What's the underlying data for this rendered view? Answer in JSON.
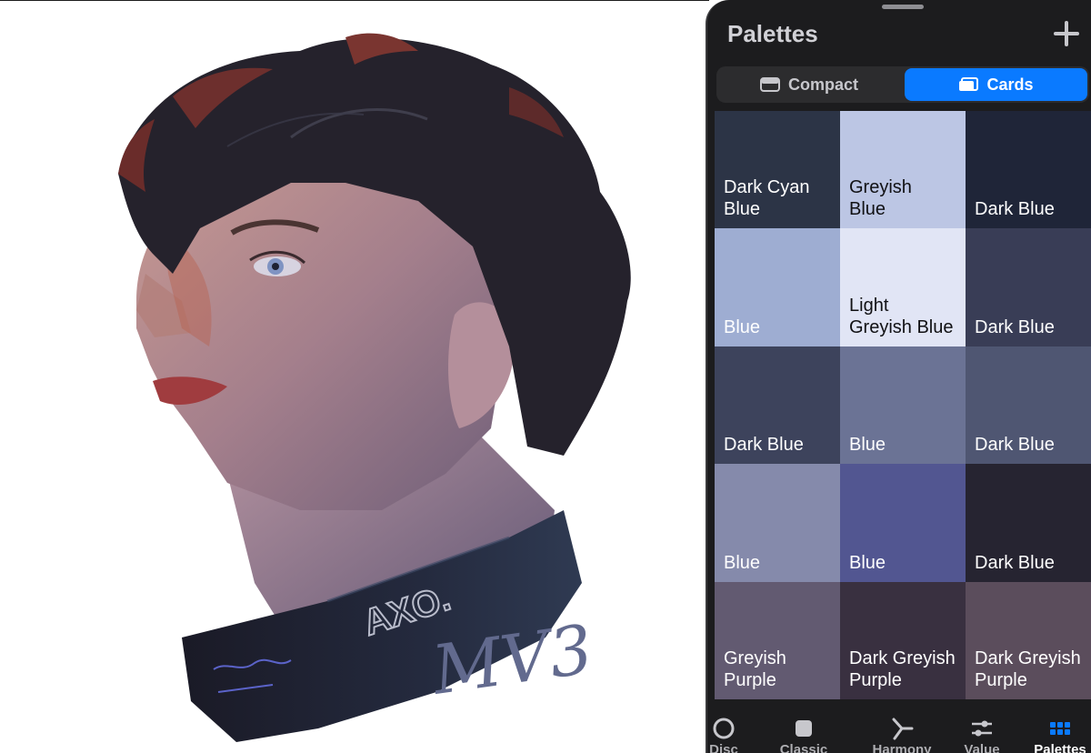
{
  "artwork": {
    "collar_brand": "AXO.",
    "signature": "MV3"
  },
  "panel": {
    "title": "Palettes",
    "add_icon": "plus-icon",
    "view_modes": [
      {
        "label": "Compact",
        "icon": "compact-card-icon",
        "selected": false
      },
      {
        "label": "Cards",
        "icon": "cards-icon",
        "selected": true
      }
    ],
    "swatches": [
      {
        "name": "Dark Cyan\nBlue",
        "color": "#2c3446",
        "text": "light"
      },
      {
        "name": "Greyish\nBlue",
        "color": "#bcc6e4",
        "text": "dark"
      },
      {
        "name": "Dark Blue",
        "color": "#1f2538",
        "text": "light"
      },
      {
        "name": "Blue",
        "color": "#9eadd2",
        "text": "light"
      },
      {
        "name": "Light\nGreyish Blue",
        "color": "#e1e5f5",
        "text": "dark"
      },
      {
        "name": "Dark Blue",
        "color": "#393d56",
        "text": "light"
      },
      {
        "name": "Dark Blue",
        "color": "#3d435c",
        "text": "light"
      },
      {
        "name": "Blue",
        "color": "#6b7395",
        "text": "light"
      },
      {
        "name": "Dark Blue",
        "color": "#4f5672",
        "text": "light"
      },
      {
        "name": "Blue",
        "color": "#858aab",
        "text": "light"
      },
      {
        "name": "Blue",
        "color": "#525691",
        "text": "light"
      },
      {
        "name": "Dark Blue",
        "color": "#262431",
        "text": "light"
      },
      {
        "name": "Greyish\nPurple",
        "color": "#625a71",
        "text": "light"
      },
      {
        "name": "Dark Greyish\nPurple",
        "color": "#393040",
        "text": "light"
      },
      {
        "name": "Dark Greyish\nPurple",
        "color": "#5b4d5c",
        "text": "light"
      }
    ]
  },
  "tabs": [
    {
      "label": "Disc",
      "icon": "disc-icon",
      "active": false
    },
    {
      "label": "Classic",
      "icon": "classic-square-icon",
      "active": false
    },
    {
      "label": "Harmony",
      "icon": "harmony-icon",
      "active": false
    },
    {
      "label": "Value",
      "icon": "value-sliders-icon",
      "active": false
    },
    {
      "label": "Palettes",
      "icon": "palettes-grid-icon",
      "active": true
    }
  ],
  "colors": {
    "accent": "#0a7aff",
    "panel_bg": "#1c1c1e"
  }
}
